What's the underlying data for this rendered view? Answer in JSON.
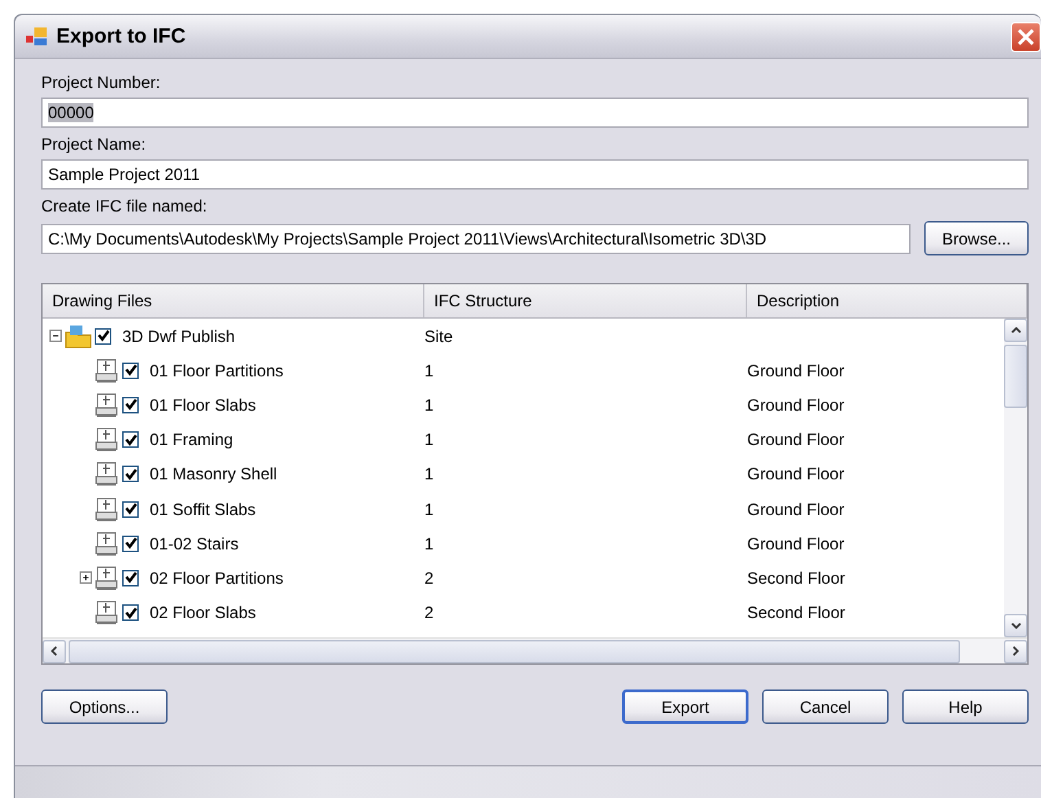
{
  "window": {
    "title": "Export to IFC"
  },
  "fields": [
    {
      "label": "Project Number:",
      "value": "00000",
      "selected": true
    },
    {
      "label": "Project Name:",
      "value": "Sample Project 2011",
      "selected": false
    },
    {
      "label": "Create IFC file named:",
      "value": "C:\\My Documents\\Autodesk\\My Projects\\Sample Project 2011\\Views\\Architectural\\Isometric 3D\\3D",
      "selected": false
    }
  ],
  "browse_button": "Browse...",
  "table": {
    "columns": [
      "Drawing Files",
      "IFC Structure",
      "Description"
    ],
    "rows": [
      {
        "kind": "folder",
        "name": "3D Dwf Publish",
        "structure": "Site",
        "checked": true,
        "expanded": true,
        "children": [
          {
            "kind": "dwg",
            "name": "01 Floor Partitions",
            "structure": "1",
            "description": "Ground Floor",
            "checked": true,
            "expandable": false
          },
          {
            "kind": "dwg",
            "name": "01 Floor Slabs",
            "structure": "1",
            "description": "Ground Floor",
            "checked": true,
            "expandable": false
          },
          {
            "kind": "dwg",
            "name": "01 Framing",
            "structure": "1",
            "description": "Ground Floor",
            "checked": true,
            "expandable": false
          },
          {
            "kind": "dwg",
            "name": "01 Masonry Shell",
            "structure": "1",
            "description": "Ground Floor",
            "checked": true,
            "expandable": false
          },
          {
            "kind": "dwg",
            "name": "01 Soffit Slabs",
            "structure": "1",
            "description": "Ground Floor",
            "checked": true,
            "expandable": false
          },
          {
            "kind": "dwg",
            "name": "01-02 Stairs",
            "structure": "1",
            "description": "Ground Floor",
            "checked": true,
            "expandable": false
          },
          {
            "kind": "dwg",
            "name": "02 Floor Partitions",
            "structure": "2",
            "description": "Second Floor",
            "checked": true,
            "expandable": true
          },
          {
            "kind": "dwg",
            "name": "02 Floor Slabs",
            "structure": "2",
            "description": "Second Floor",
            "checked": true,
            "expandable": false
          }
        ]
      }
    ]
  },
  "buttons": [
    {
      "label": "Options...",
      "kind": "left"
    },
    {
      "label": "Export",
      "kind": "default"
    },
    {
      "label": "Cancel",
      "kind": "normal"
    },
    {
      "label": "Help",
      "kind": "normal"
    }
  ]
}
